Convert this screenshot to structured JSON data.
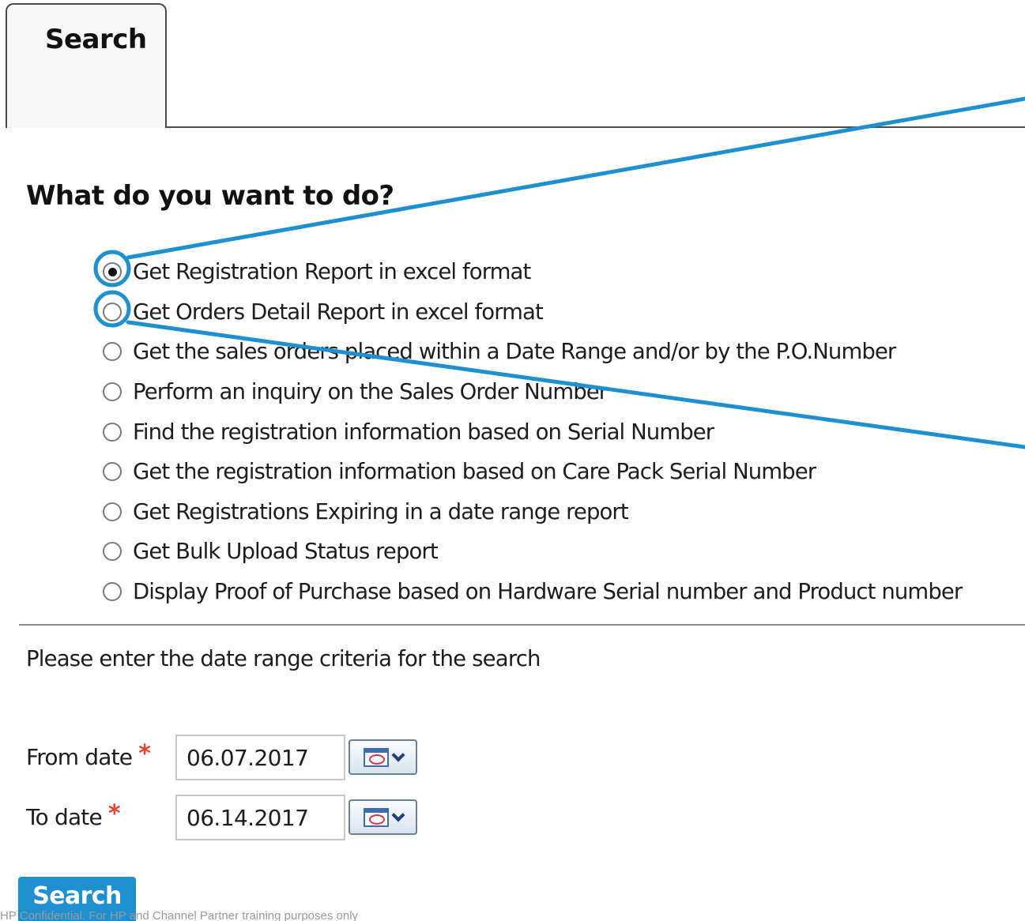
{
  "tab": {
    "label": "Search"
  },
  "heading": "What do you want to do?",
  "options": [
    {
      "label": "Get Registration Report in excel format",
      "selected": true
    },
    {
      "label": "Get Orders Detail Report in excel format",
      "selected": false
    },
    {
      "label": "Get the sales orders placed within a Date Range and/or by the P.O.Number",
      "selected": false
    },
    {
      "label": "Perform an inquiry on the Sales Order Number",
      "selected": false
    },
    {
      "label": "Find the registration information based on Serial Number",
      "selected": false
    },
    {
      "label": "Get the registration information based on Care Pack Serial Number",
      "selected": false
    },
    {
      "label": "Get Registrations Expiring in a date range report",
      "selected": false
    },
    {
      "label": "Get Bulk Upload Status report",
      "selected": false
    },
    {
      "label": "Display Proof of Purchase based on Hardware Serial number and Product number",
      "selected": false
    }
  ],
  "instructions": "Please enter the date range criteria for the search",
  "from_date": {
    "label": "From date",
    "required_mark": "*",
    "value": "06.07.2017",
    "calendar_icon": "calendar-icon",
    "dropdown_icon": "chevron-down-icon"
  },
  "to_date": {
    "label": "To date",
    "required_mark": "*",
    "value": "06.14.2017",
    "calendar_icon": "calendar-icon",
    "dropdown_icon": "chevron-down-icon"
  },
  "search_button": {
    "label": "Search"
  },
  "footer_note": "HP Confidential. For HP and Channel Partner training purposes only",
  "colors": {
    "accent": "#1e8fcf",
    "callout": "#1e8fcf",
    "required": "#e8452c"
  }
}
